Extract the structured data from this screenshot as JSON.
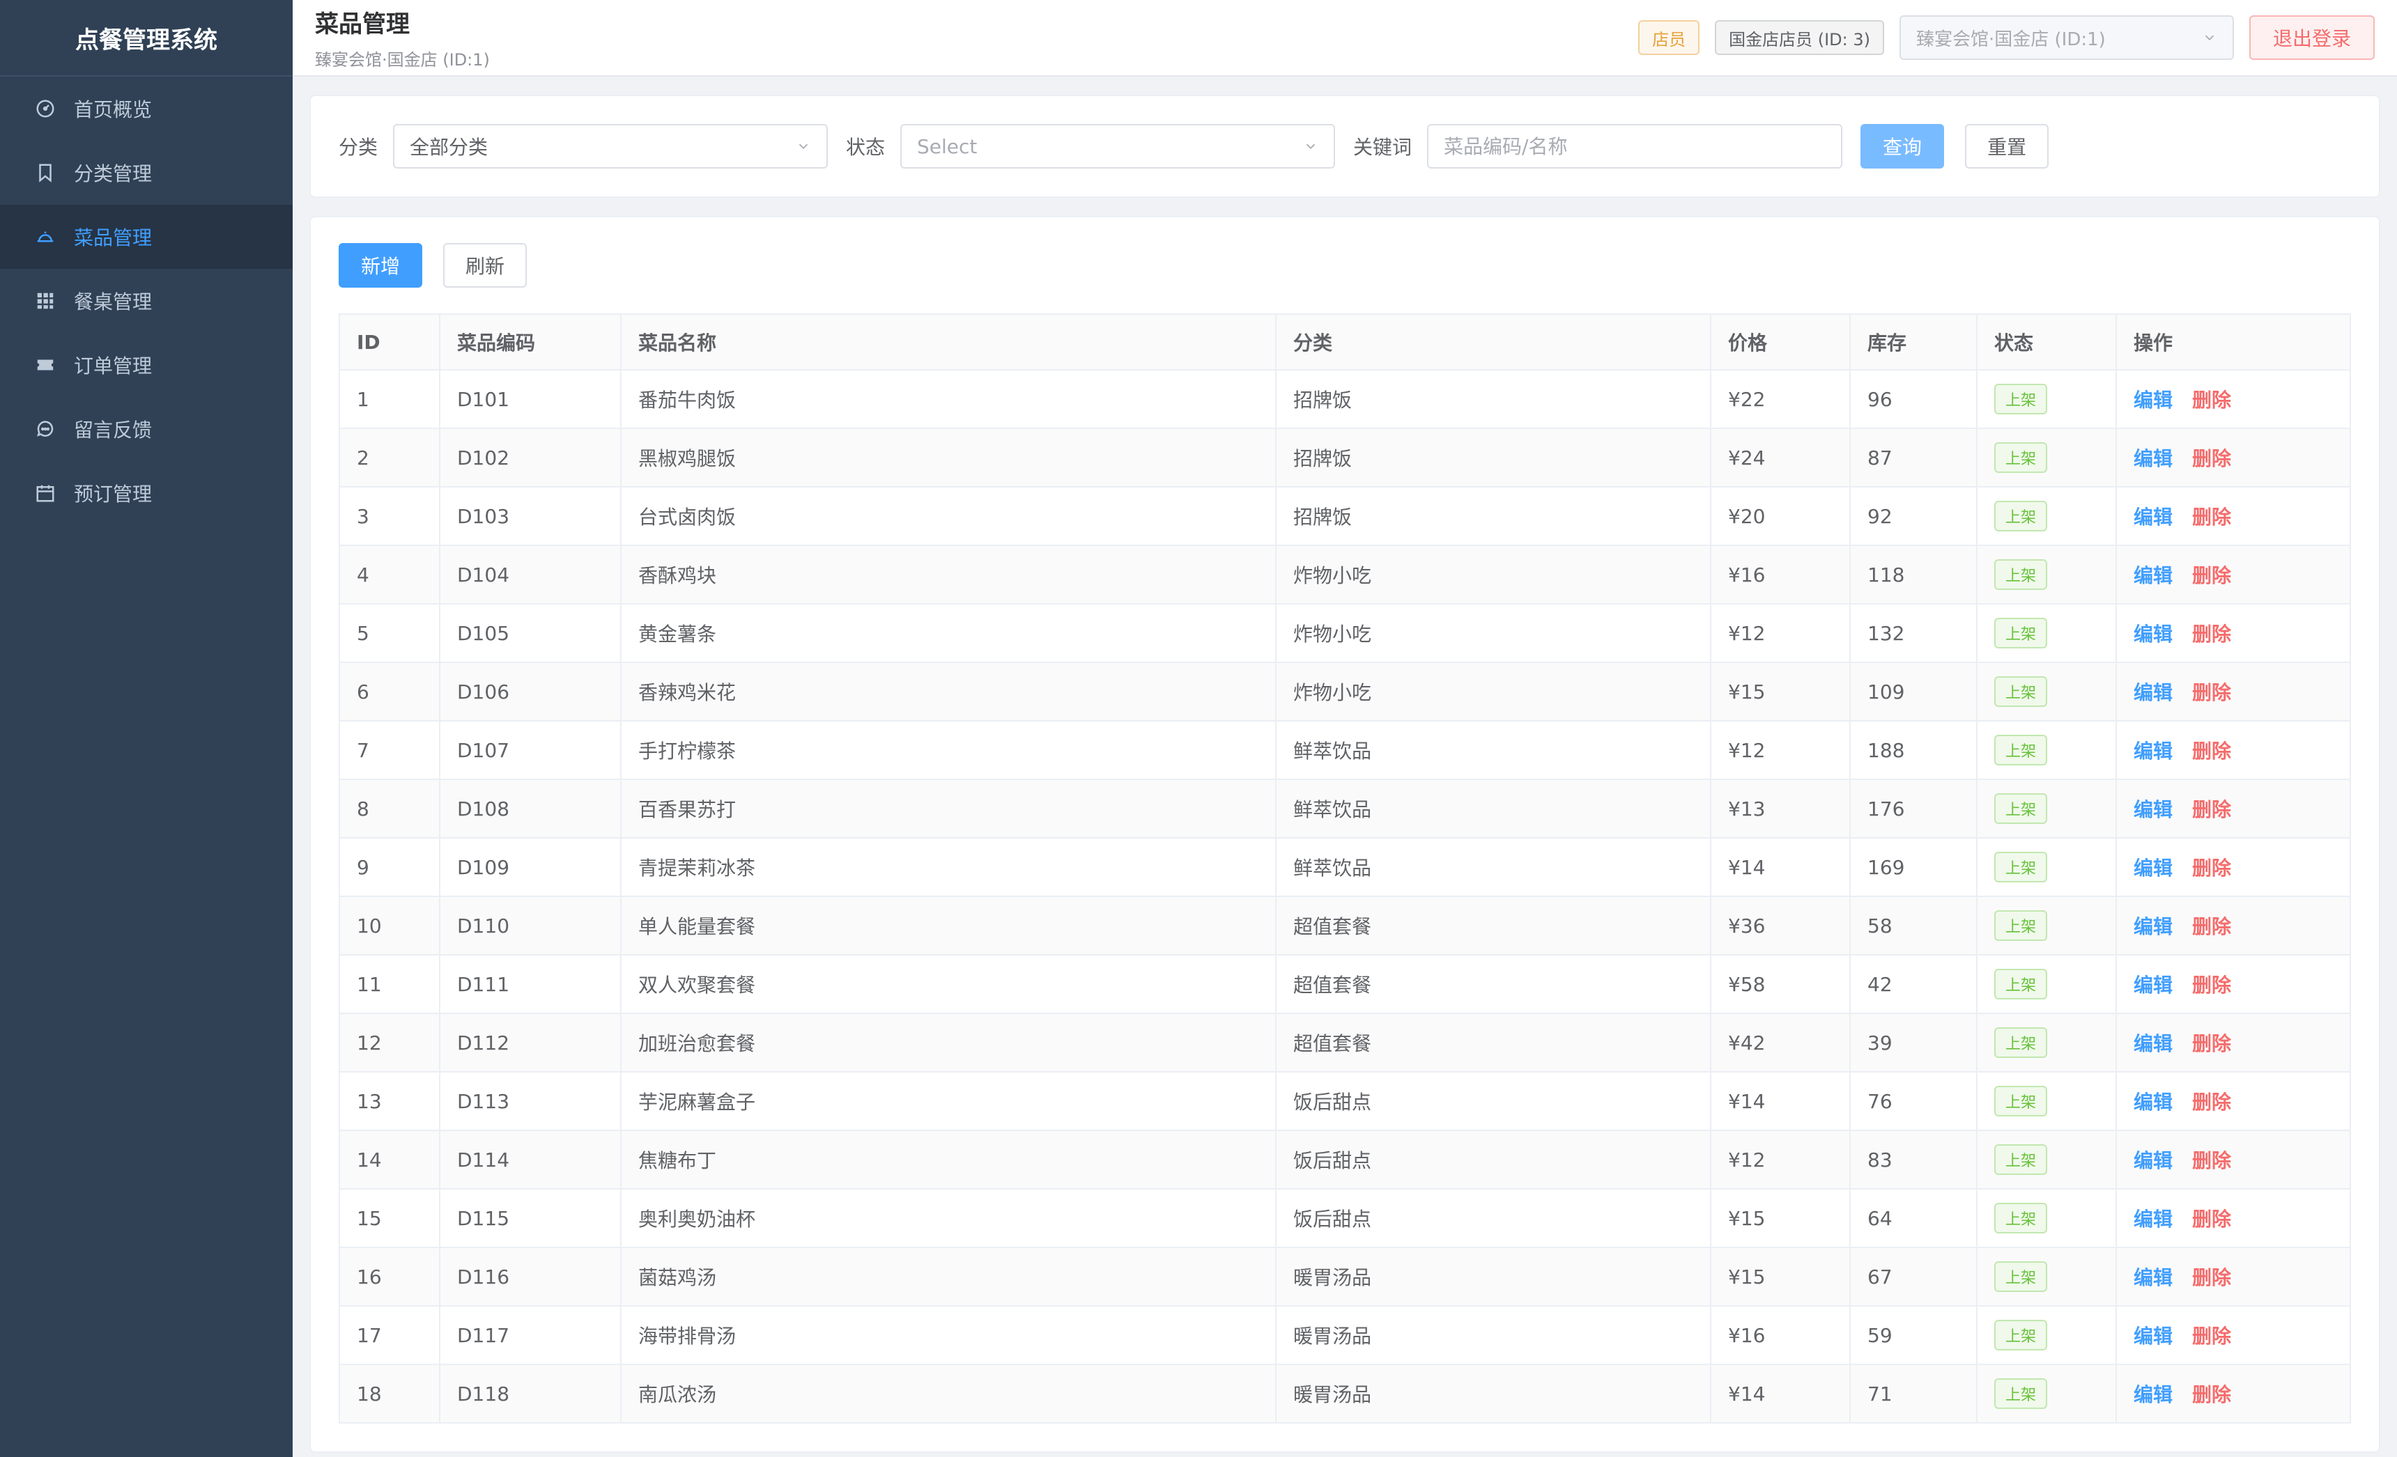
{
  "sidebar": {
    "brand": "点餐管理系统",
    "items": [
      {
        "label": "首页概览",
        "icon": "dashboard-icon",
        "active": false
      },
      {
        "label": "分类管理",
        "icon": "bookmark-icon",
        "active": false
      },
      {
        "label": "菜品管理",
        "icon": "dish-icon",
        "active": true
      },
      {
        "label": "餐桌管理",
        "icon": "grid-icon",
        "active": false
      },
      {
        "label": "订单管理",
        "icon": "ticket-icon",
        "active": false
      },
      {
        "label": "留言反馈",
        "icon": "chat-icon",
        "active": false
      },
      {
        "label": "预订管理",
        "icon": "calendar-icon",
        "active": false
      }
    ]
  },
  "header": {
    "title": "菜品管理",
    "subtitle": "臻宴会馆·国金店 (ID:1)",
    "role_tag": "店员",
    "user_tag": "国金店店员 (ID: 3)",
    "store_select": "臻宴会馆·国金店 (ID:1)",
    "logout_label": "退出登录"
  },
  "filter": {
    "category_label": "分类",
    "category_value": "全部分类",
    "status_label": "状态",
    "status_placeholder": "Select",
    "keyword_label": "关键词",
    "keyword_placeholder": "菜品编码/名称",
    "keyword_value": "",
    "query_label": "查询",
    "reset_label": "重置"
  },
  "toolbar": {
    "add_label": "新增",
    "refresh_label": "刷新"
  },
  "table": {
    "columns": [
      "ID",
      "菜品编码",
      "菜品名称",
      "分类",
      "价格",
      "库存",
      "状态",
      "操作"
    ],
    "edit_label": "编辑",
    "delete_label": "删除",
    "rows": [
      {
        "id": "1",
        "code": "D101",
        "name": "番茄牛肉饭",
        "category": "招牌饭",
        "price": "¥22",
        "stock": "96",
        "status": "上架"
      },
      {
        "id": "2",
        "code": "D102",
        "name": "黑椒鸡腿饭",
        "category": "招牌饭",
        "price": "¥24",
        "stock": "87",
        "status": "上架"
      },
      {
        "id": "3",
        "code": "D103",
        "name": "台式卤肉饭",
        "category": "招牌饭",
        "price": "¥20",
        "stock": "92",
        "status": "上架"
      },
      {
        "id": "4",
        "code": "D104",
        "name": "香酥鸡块",
        "category": "炸物小吃",
        "price": "¥16",
        "stock": "118",
        "status": "上架"
      },
      {
        "id": "5",
        "code": "D105",
        "name": "黄金薯条",
        "category": "炸物小吃",
        "price": "¥12",
        "stock": "132",
        "status": "上架"
      },
      {
        "id": "6",
        "code": "D106",
        "name": "香辣鸡米花",
        "category": "炸物小吃",
        "price": "¥15",
        "stock": "109",
        "status": "上架"
      },
      {
        "id": "7",
        "code": "D107",
        "name": "手打柠檬茶",
        "category": "鲜萃饮品",
        "price": "¥12",
        "stock": "188",
        "status": "上架"
      },
      {
        "id": "8",
        "code": "D108",
        "name": "百香果苏打",
        "category": "鲜萃饮品",
        "price": "¥13",
        "stock": "176",
        "status": "上架"
      },
      {
        "id": "9",
        "code": "D109",
        "name": "青提茉莉冰茶",
        "category": "鲜萃饮品",
        "price": "¥14",
        "stock": "169",
        "status": "上架"
      },
      {
        "id": "10",
        "code": "D110",
        "name": "单人能量套餐",
        "category": "超值套餐",
        "price": "¥36",
        "stock": "58",
        "status": "上架"
      },
      {
        "id": "11",
        "code": "D111",
        "name": "双人欢聚套餐",
        "category": "超值套餐",
        "price": "¥58",
        "stock": "42",
        "status": "上架"
      },
      {
        "id": "12",
        "code": "D112",
        "name": "加班治愈套餐",
        "category": "超值套餐",
        "price": "¥42",
        "stock": "39",
        "status": "上架"
      },
      {
        "id": "13",
        "code": "D113",
        "name": "芋泥麻薯盒子",
        "category": "饭后甜点",
        "price": "¥14",
        "stock": "76",
        "status": "上架"
      },
      {
        "id": "14",
        "code": "D114",
        "name": "焦糖布丁",
        "category": "饭后甜点",
        "price": "¥12",
        "stock": "83",
        "status": "上架"
      },
      {
        "id": "15",
        "code": "D115",
        "name": "奥利奥奶油杯",
        "category": "饭后甜点",
        "price": "¥15",
        "stock": "64",
        "status": "上架"
      },
      {
        "id": "16",
        "code": "D116",
        "name": "菌菇鸡汤",
        "category": "暖胃汤品",
        "price": "¥15",
        "stock": "67",
        "status": "上架"
      },
      {
        "id": "17",
        "code": "D117",
        "name": "海带排骨汤",
        "category": "暖胃汤品",
        "price": "¥16",
        "stock": "59",
        "status": "上架"
      },
      {
        "id": "18",
        "code": "D118",
        "name": "南瓜浓汤",
        "category": "暖胃汤品",
        "price": "¥14",
        "stock": "71",
        "status": "上架"
      }
    ]
  },
  "colors": {
    "sidebar_bg": "#304156",
    "accent": "#409eff",
    "danger": "#f56c6c",
    "success": "#67c23a",
    "warning": "#e6a23c"
  }
}
